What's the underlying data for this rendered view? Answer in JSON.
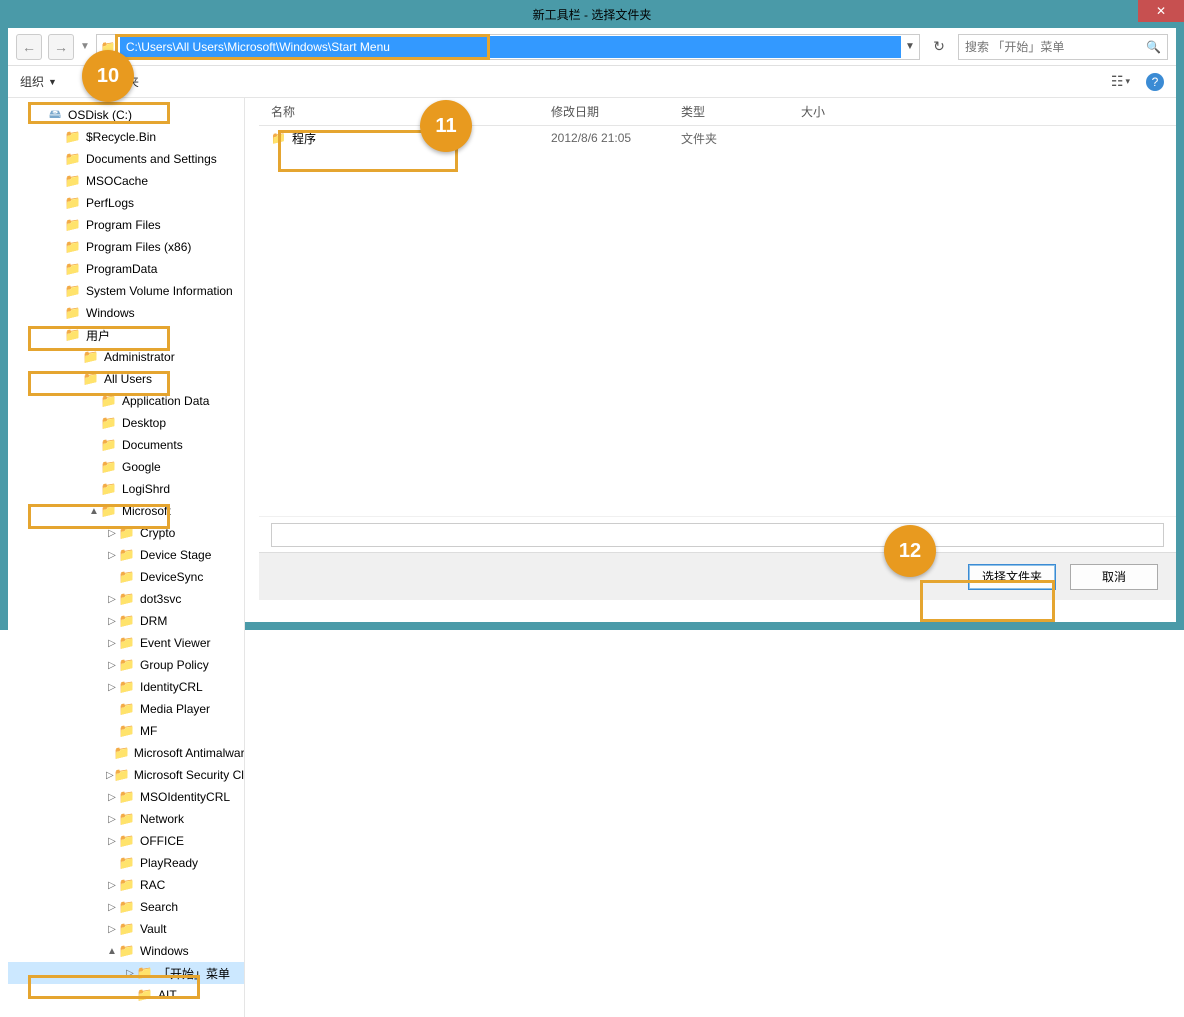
{
  "title": "新工具栏 - 选择文件夹",
  "close_symbol": "✕",
  "nav": {
    "back": "←",
    "forward": "→",
    "dropdown": "▼",
    "refresh": "↻",
    "address": "C:\\Users\\All Users\\Microsoft\\Windows\\Start Menu",
    "search_placeholder": "搜索 「开始」菜单",
    "search_icon": "🔍"
  },
  "toolbar": {
    "organize": "组织",
    "newfolder_suffix": "夹",
    "view_icon": "☷",
    "view_dd": "▾",
    "help": "?"
  },
  "columns": {
    "name": "名称",
    "date": "修改日期",
    "type": "类型",
    "size": "大小"
  },
  "rows": [
    {
      "icon": "📁",
      "name": "程序",
      "date": "2012/8/6 21:05",
      "type": "文件夹",
      "size": ""
    }
  ],
  "tree": [
    {
      "lv": 1,
      "exp": "",
      "icon": "drive",
      "label": "OSDisk (C:)"
    },
    {
      "lv": 2,
      "exp": "",
      "icon": "folder",
      "label": "$Recycle.Bin"
    },
    {
      "lv": 2,
      "exp": "",
      "icon": "folder",
      "label": "Documents and Settings"
    },
    {
      "lv": 2,
      "exp": "",
      "icon": "folder",
      "label": "MSOCache"
    },
    {
      "lv": 2,
      "exp": "",
      "icon": "folder",
      "label": "PerfLogs"
    },
    {
      "lv": 2,
      "exp": "",
      "icon": "folder",
      "label": "Program Files"
    },
    {
      "lv": 2,
      "exp": "",
      "icon": "folder",
      "label": "Program Files (x86)"
    },
    {
      "lv": 2,
      "exp": "",
      "icon": "folder",
      "label": "ProgramData"
    },
    {
      "lv": 2,
      "exp": "",
      "icon": "folder",
      "label": "System Volume Information"
    },
    {
      "lv": 2,
      "exp": "",
      "icon": "folder",
      "label": "Windows"
    },
    {
      "lv": 2,
      "exp": "",
      "icon": "folder",
      "label": "用户"
    },
    {
      "lv": 3,
      "exp": "",
      "icon": "folder",
      "label": "Administrator"
    },
    {
      "lv": 3,
      "exp": "",
      "icon": "shortcut",
      "label": "All Users"
    },
    {
      "lv": 4,
      "exp": "",
      "icon": "shortcut",
      "label": "Application Data"
    },
    {
      "lv": 4,
      "exp": "",
      "icon": "folder",
      "label": "Desktop"
    },
    {
      "lv": 4,
      "exp": "",
      "icon": "folder",
      "label": "Documents"
    },
    {
      "lv": 4,
      "exp": "",
      "icon": "folder",
      "label": "Google"
    },
    {
      "lv": 4,
      "exp": "",
      "icon": "folder",
      "label": "LogiShrd"
    },
    {
      "lv": 4,
      "exp": "▲",
      "icon": "folder",
      "label": "Microsoft"
    },
    {
      "lv": 5,
      "exp": "▷",
      "icon": "folder",
      "label": "Crypto"
    },
    {
      "lv": 5,
      "exp": "▷",
      "icon": "folder",
      "label": "Device Stage"
    },
    {
      "lv": 5,
      "exp": "",
      "icon": "folder",
      "label": "DeviceSync"
    },
    {
      "lv": 5,
      "exp": "▷",
      "icon": "folder",
      "label": "dot3svc"
    },
    {
      "lv": 5,
      "exp": "▷",
      "icon": "folder",
      "label": "DRM"
    },
    {
      "lv": 5,
      "exp": "▷",
      "icon": "folder",
      "label": "Event Viewer"
    },
    {
      "lv": 5,
      "exp": "▷",
      "icon": "folder",
      "label": "Group Policy"
    },
    {
      "lv": 5,
      "exp": "▷",
      "icon": "folder",
      "label": "IdentityCRL"
    },
    {
      "lv": 5,
      "exp": "",
      "icon": "folder",
      "label": "Media Player"
    },
    {
      "lv": 5,
      "exp": "",
      "icon": "folder",
      "label": "MF"
    },
    {
      "lv": 5,
      "exp": "",
      "icon": "folder",
      "label": "Microsoft Antimalware"
    },
    {
      "lv": 5,
      "exp": "▷",
      "icon": "folder",
      "label": "Microsoft Security Clien"
    },
    {
      "lv": 5,
      "exp": "▷",
      "icon": "folder",
      "label": "MSOIdentityCRL"
    },
    {
      "lv": 5,
      "exp": "▷",
      "icon": "folder",
      "label": "Network"
    },
    {
      "lv": 5,
      "exp": "▷",
      "icon": "folder",
      "label": "OFFICE"
    },
    {
      "lv": 5,
      "exp": "",
      "icon": "folder",
      "label": "PlayReady"
    },
    {
      "lv": 5,
      "exp": "▷",
      "icon": "folder",
      "label": "RAC"
    },
    {
      "lv": 5,
      "exp": "▷",
      "icon": "folder",
      "label": "Search"
    },
    {
      "lv": 5,
      "exp": "▷",
      "icon": "folder",
      "label": "Vault"
    },
    {
      "lv": 5,
      "exp": "▲",
      "icon": "folder",
      "label": "Windows"
    },
    {
      "lv": 6,
      "exp": "▷",
      "icon": "folder",
      "label": "「开始」菜单",
      "selected": true
    },
    {
      "lv": 6,
      "exp": "",
      "icon": "folder",
      "label": "AIT"
    }
  ],
  "buttons": {
    "select": "选择文件夹",
    "cancel": "取消"
  },
  "badges": {
    "b10": "10",
    "b11": "11",
    "b12": "12"
  }
}
